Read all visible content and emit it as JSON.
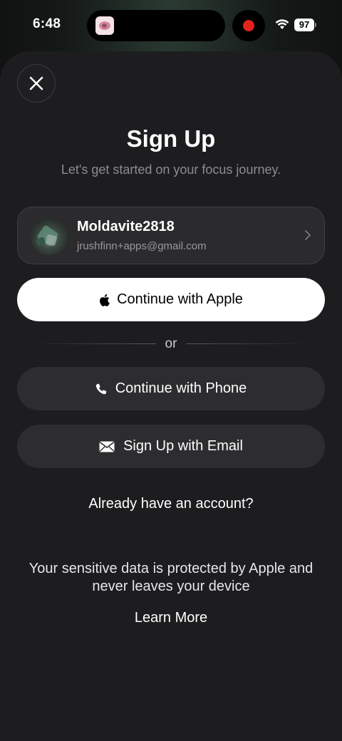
{
  "status_bar": {
    "time": "6:48",
    "battery": "97"
  },
  "icons": {
    "close": "close-icon",
    "apple": "apple-icon",
    "phone": "phone-icon",
    "email": "envelope-icon",
    "chevron": "chevron-right-icon",
    "wifi": "wifi-icon"
  },
  "colors": {
    "sheet": "#1d1d1f",
    "primary_button": "#ffffff",
    "secondary_button": "#2d2d30",
    "recording": "#e0241c"
  },
  "header": {
    "title": "Sign Up",
    "subtitle": "Let's get started on your focus journey."
  },
  "account": {
    "name": "Moldavite2818",
    "email": "jrushfinn+apps@gmail.com"
  },
  "buttons": {
    "apple": "Continue with Apple",
    "divider": "or",
    "phone": "Continue with Phone",
    "email": "Sign Up with Email"
  },
  "footer": {
    "login": "Already have an account?",
    "privacy": "Your sensitive data is protected by Apple and never leaves your device",
    "learn_more": "Learn More"
  }
}
